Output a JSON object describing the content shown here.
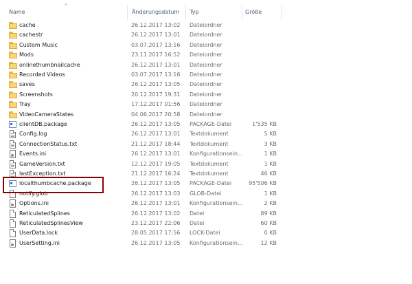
{
  "columns": {
    "name": "Name",
    "date": "Änderungsdatum",
    "type": "Typ",
    "size": "Größe"
  },
  "sort_indicator": "^",
  "files": [
    {
      "name": "cache",
      "date": "26.12.2017 13:02",
      "type": "Dateiordner",
      "size": "",
      "icon": "folder-icon"
    },
    {
      "name": "cachestr",
      "date": "26.12.2017 13:01",
      "type": "Dateiordner",
      "size": "",
      "icon": "folder-icon"
    },
    {
      "name": "Custom Music",
      "date": "03.07.2017 13:16",
      "type": "Dateiordner",
      "size": "",
      "icon": "folder-icon"
    },
    {
      "name": "Mods",
      "date": "23.11.2017 16:52",
      "type": "Dateiordner",
      "size": "",
      "icon": "folder-icon"
    },
    {
      "name": "onlinethumbnailcache",
      "date": "26.12.2017 13:01",
      "type": "Dateiordner",
      "size": "",
      "icon": "folder-icon"
    },
    {
      "name": "Recorded Videos",
      "date": "03.07.2017 13:16",
      "type": "Dateiordner",
      "size": "",
      "icon": "folder-icon"
    },
    {
      "name": "saves",
      "date": "26.12.2017 13:05",
      "type": "Dateiordner",
      "size": "",
      "icon": "folder-icon"
    },
    {
      "name": "Screenshots",
      "date": "20.12.2017 19:31",
      "type": "Dateiordner",
      "size": "",
      "icon": "folder-icon"
    },
    {
      "name": "Tray",
      "date": "17.12.2017 01:56",
      "type": "Dateiordner",
      "size": "",
      "icon": "folder-icon"
    },
    {
      "name": "VideoCameraStates",
      "date": "04.06.2017 20:58",
      "type": "Dateiordner",
      "size": "",
      "icon": "folder-icon"
    },
    {
      "name": "clientDB.package",
      "date": "26.12.2017 13:05",
      "type": "PACKAGE-Datei",
      "size": "1'535 KB",
      "icon": "package-file-icon"
    },
    {
      "name": "Config.log",
      "date": "26.12.2017 13:01",
      "type": "Textdokument",
      "size": "5 KB",
      "icon": "text-file-icon"
    },
    {
      "name": "ConnectionStatus.txt",
      "date": "21.12.2017 18:44",
      "type": "Textdokument",
      "size": "3 KB",
      "icon": "text-file-icon"
    },
    {
      "name": "Events.ini",
      "date": "26.12.2017 13:01",
      "type": "Konfigurationsein...",
      "size": "1 KB",
      "icon": "config-file-icon"
    },
    {
      "name": "GameVersion.txt",
      "date": "12.12.2017 19:05",
      "type": "Textdokument",
      "size": "1 KB",
      "icon": "text-file-icon"
    },
    {
      "name": "lastException.txt",
      "date": "21.12.2017 16:24",
      "type": "Textdokument",
      "size": "46 KB",
      "icon": "text-file-icon"
    },
    {
      "name": "localthumbcache.package",
      "date": "26.12.2017 13:05",
      "type": "PACKAGE-Datei",
      "size": "95'506 KB",
      "icon": "package-file-icon"
    },
    {
      "name": "notify.glob",
      "date": "26.12.2017 13:03",
      "type": "GLOB-Datei",
      "size": "1 KB",
      "icon": "file-icon"
    },
    {
      "name": "Options.ini",
      "date": "26.12.2017 13:01",
      "type": "Konfigurationsein...",
      "size": "2 KB",
      "icon": "config-file-icon"
    },
    {
      "name": "ReticulatedSplines",
      "date": "26.12.2017 13:02",
      "type": "Datei",
      "size": "89 KB",
      "icon": "file-icon"
    },
    {
      "name": "ReticulatedSplinesView",
      "date": "23.12.2017 22:06",
      "type": "Datei",
      "size": "60 KB",
      "icon": "file-icon"
    },
    {
      "name": "UserData.lock",
      "date": "28.05.2017 17:56",
      "type": "LOCK-Datei",
      "size": "0 KB",
      "icon": "file-icon"
    },
    {
      "name": "UserSetting.ini",
      "date": "26.12.2017 13:05",
      "type": "Konfigurationsein...",
      "size": "12 KB",
      "icon": "config-file-icon"
    }
  ],
  "highlight_color": "#8b0000",
  "highlighted_file": "localthumbcache.package"
}
